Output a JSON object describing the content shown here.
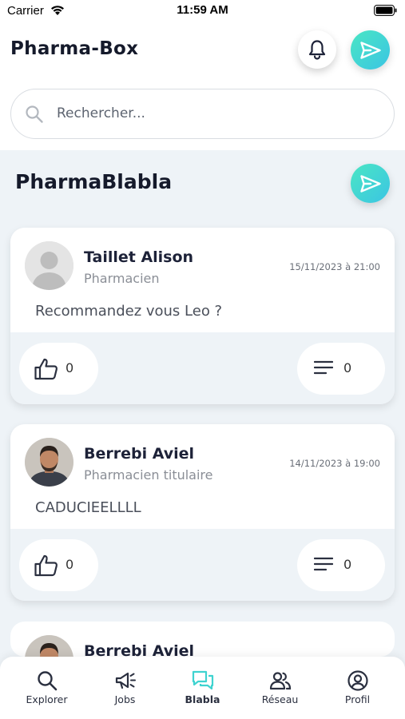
{
  "status_bar": {
    "carrier": "Carrier",
    "time": "11:59 AM"
  },
  "header": {
    "title": "Pharma-Box",
    "bell_icon": "bell-icon",
    "send_icon": "paper-plane-icon"
  },
  "search": {
    "placeholder": "Rechercher..."
  },
  "section": {
    "title": "PharmaBlabla"
  },
  "posts": [
    {
      "author": "Taillet Alison",
      "role": "Pharmacien",
      "date": "15/11/2023 à 21:00",
      "text": "Recommandez vous Leo ?",
      "likes": "0",
      "comments": "0"
    },
    {
      "author": "Berrebi Aviel",
      "role": "Pharmacien titulaire",
      "date": "14/11/2023 à 19:00",
      "text": "CADUCIEELLLL",
      "likes": "0",
      "comments": "0"
    },
    {
      "author": "Berrebi Aviel"
    }
  ],
  "nav": [
    {
      "label": "Explorer",
      "icon": "search-icon"
    },
    {
      "label": "Jobs",
      "icon": "megaphone-icon"
    },
    {
      "label": "Blabla",
      "icon": "chat-icon",
      "active": true
    },
    {
      "label": "Réseau",
      "icon": "people-icon"
    },
    {
      "label": "Profil",
      "icon": "profile-icon"
    }
  ],
  "colors": {
    "accent": "#3fd3d0",
    "accent_gradient_start": "#4ae6c4",
    "accent_gradient_end": "#3bc5e3",
    "background": "#eef3f7",
    "text_dark": "#151a2b"
  }
}
